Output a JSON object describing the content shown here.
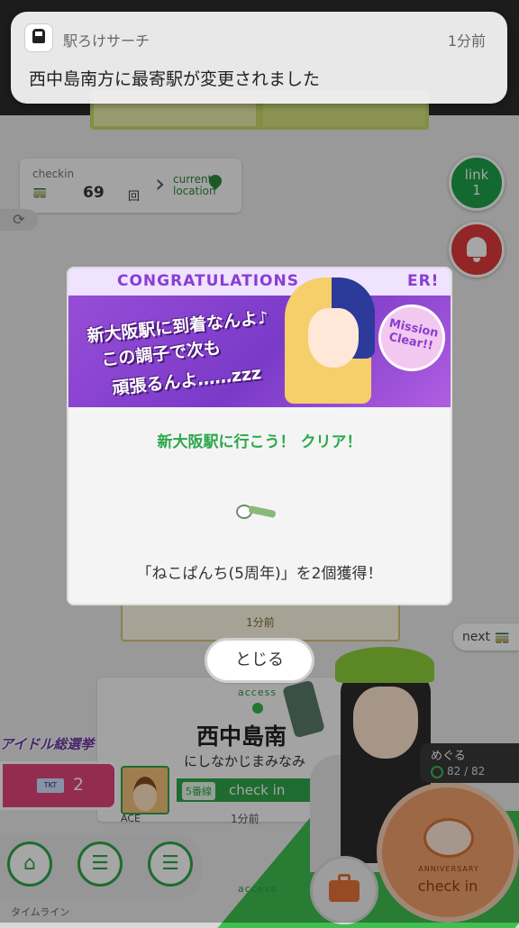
{
  "notification": {
    "app_name": "駅ろけサーチ",
    "time": "1分前",
    "message": "西中島南方に最寄駅が変更されました"
  },
  "checkin_card": {
    "label": "checkin",
    "count": "69",
    "count_unit": "回",
    "location_label_1": "current",
    "location_label_2": "location"
  },
  "link_button": {
    "line1": "link",
    "line2": "1"
  },
  "log_card": {
    "time": "1分前"
  },
  "next_tab": {
    "label": "next"
  },
  "modal": {
    "banner_title": "CONGRATULATIONS",
    "banner_title_tail": "ER!",
    "banner_lines": [
      "新大阪駅に到着なんよ♪",
      "この調子で次も",
      "頑張るんよ……zzz"
    ],
    "mission_badge": "Mission Clear!!",
    "message": "新大阪駅に行こう！ クリア！",
    "reward": "「ねこぱんち(5周年)」を2個獲得！"
  },
  "close_button": {
    "label": "とじる"
  },
  "access_card": {
    "label": "access",
    "station_name": "西中島南",
    "station_kana": "にしなかじまみなみ",
    "line_tag": "5番線",
    "checkin_label": "check in",
    "time": "1分前",
    "user_name": "ACE"
  },
  "idol_banner": {
    "text": "アイドル総選挙"
  },
  "ticket": {
    "count": "2"
  },
  "character_status": {
    "name": "めぐる",
    "hp": "82 / 82"
  },
  "bottom": {
    "timeline_label": "タイムライン",
    "access_label": "access",
    "checkin_button": "check in",
    "anniversary": "ANNIVERSARY"
  }
}
